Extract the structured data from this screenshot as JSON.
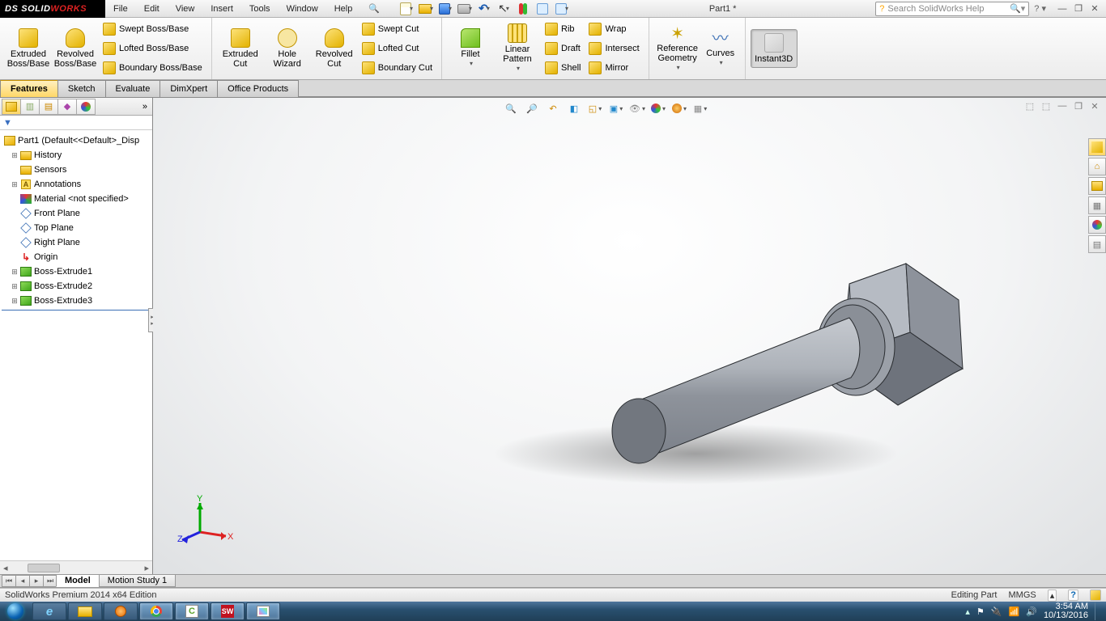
{
  "app": {
    "name_solid": "SOLID",
    "name_works": "WORKS",
    "doc_title": "Part1 *"
  },
  "menubar": [
    "File",
    "Edit",
    "View",
    "Insert",
    "Tools",
    "Window",
    "Help"
  ],
  "search_placeholder": "Search SolidWorks Help",
  "ribbon": {
    "extruded_boss": "Extruded Boss/Base",
    "revolved_boss": "Revolved Boss/Base",
    "swept_boss": "Swept Boss/Base",
    "lofted_boss": "Lofted Boss/Base",
    "boundary_boss": "Boundary Boss/Base",
    "extruded_cut": "Extruded Cut",
    "hole_wizard": "Hole Wizard",
    "revolved_cut": "Revolved Cut",
    "swept_cut": "Swept Cut",
    "lofted_cut": "Lofted Cut",
    "boundary_cut": "Boundary Cut",
    "fillet": "Fillet",
    "linear_pattern": "Linear Pattern",
    "rib": "Rib",
    "draft": "Draft",
    "shell": "Shell",
    "wrap": "Wrap",
    "intersect": "Intersect",
    "mirror": "Mirror",
    "ref_geom": "Reference Geometry",
    "curves": "Curves",
    "instant3d": "Instant3D"
  },
  "cm_tabs": [
    "Features",
    "Sketch",
    "Evaluate",
    "DimXpert",
    "Office Products"
  ],
  "tree": {
    "root": "Part1  (Default<<Default>_Disp",
    "history": "History",
    "sensors": "Sensors",
    "annotations": "Annotations",
    "material": "Material <not specified>",
    "front": "Front Plane",
    "top": "Top Plane",
    "right": "Right Plane",
    "origin": "Origin",
    "be1": "Boss-Extrude1",
    "be2": "Boss-Extrude2",
    "be3": "Boss-Extrude3"
  },
  "triad": {
    "x": "X",
    "y": "Y",
    "z": "Z"
  },
  "bottom_tabs": {
    "model": "Model",
    "motion": "Motion Study 1"
  },
  "status": {
    "left": "SolidWorks Premium 2014 x64 Edition",
    "mode": "Editing Part",
    "units": "MMGS"
  },
  "clock": {
    "time": "3:54 AM",
    "date": "10/13/2016"
  }
}
